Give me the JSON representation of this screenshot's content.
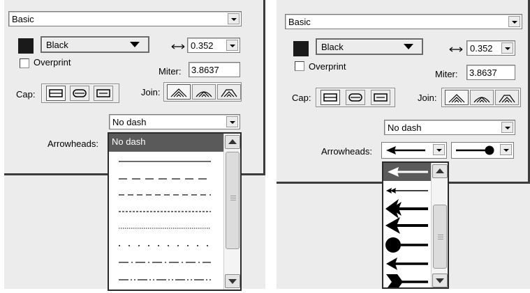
{
  "left_panel": {
    "style_select": "Basic",
    "color_name": "Black",
    "width_value": "0.352",
    "overprint_label": "Overprint",
    "miter_label": "Miter:",
    "miter_value": "3.8637",
    "cap_label": "Cap:",
    "join_label": "Join:",
    "dash_select": "No dash",
    "arrowheads_label": "Arrowheads:",
    "dash_list": {
      "items": [
        "No dash",
        "long-dash",
        "medium-dash",
        "short-dash",
        "dotted",
        "fine-dotted",
        "sparse-dotted",
        "dash-dot",
        "dash-dot-dot"
      ],
      "selected_index": 0
    }
  },
  "right_panel": {
    "style_select": "Basic",
    "color_name": "Black",
    "width_value": "0.352",
    "overprint_label": "Overprint",
    "miter_label": "Miter:",
    "miter_value": "3.8637",
    "cap_label": "Cap:",
    "join_label": "Join:",
    "dash_select": "No dash",
    "arrowheads_label": "Arrowheads:",
    "start_arrowhead": "arrow-left-icon",
    "end_arrowhead": "circle-end-icon",
    "arrowhead_list": {
      "items": [
        "arrow-left-open",
        "double-barb-left",
        "triple-barb-left",
        "feather-barb-left",
        "circle-left",
        "barb-left",
        "chevron-tail-right"
      ],
      "selected_index": 0
    }
  },
  "colors": {
    "panel_bg": "#ececec",
    "selection": "#5a5a5a",
    "swatch": "#1a1a1a"
  }
}
